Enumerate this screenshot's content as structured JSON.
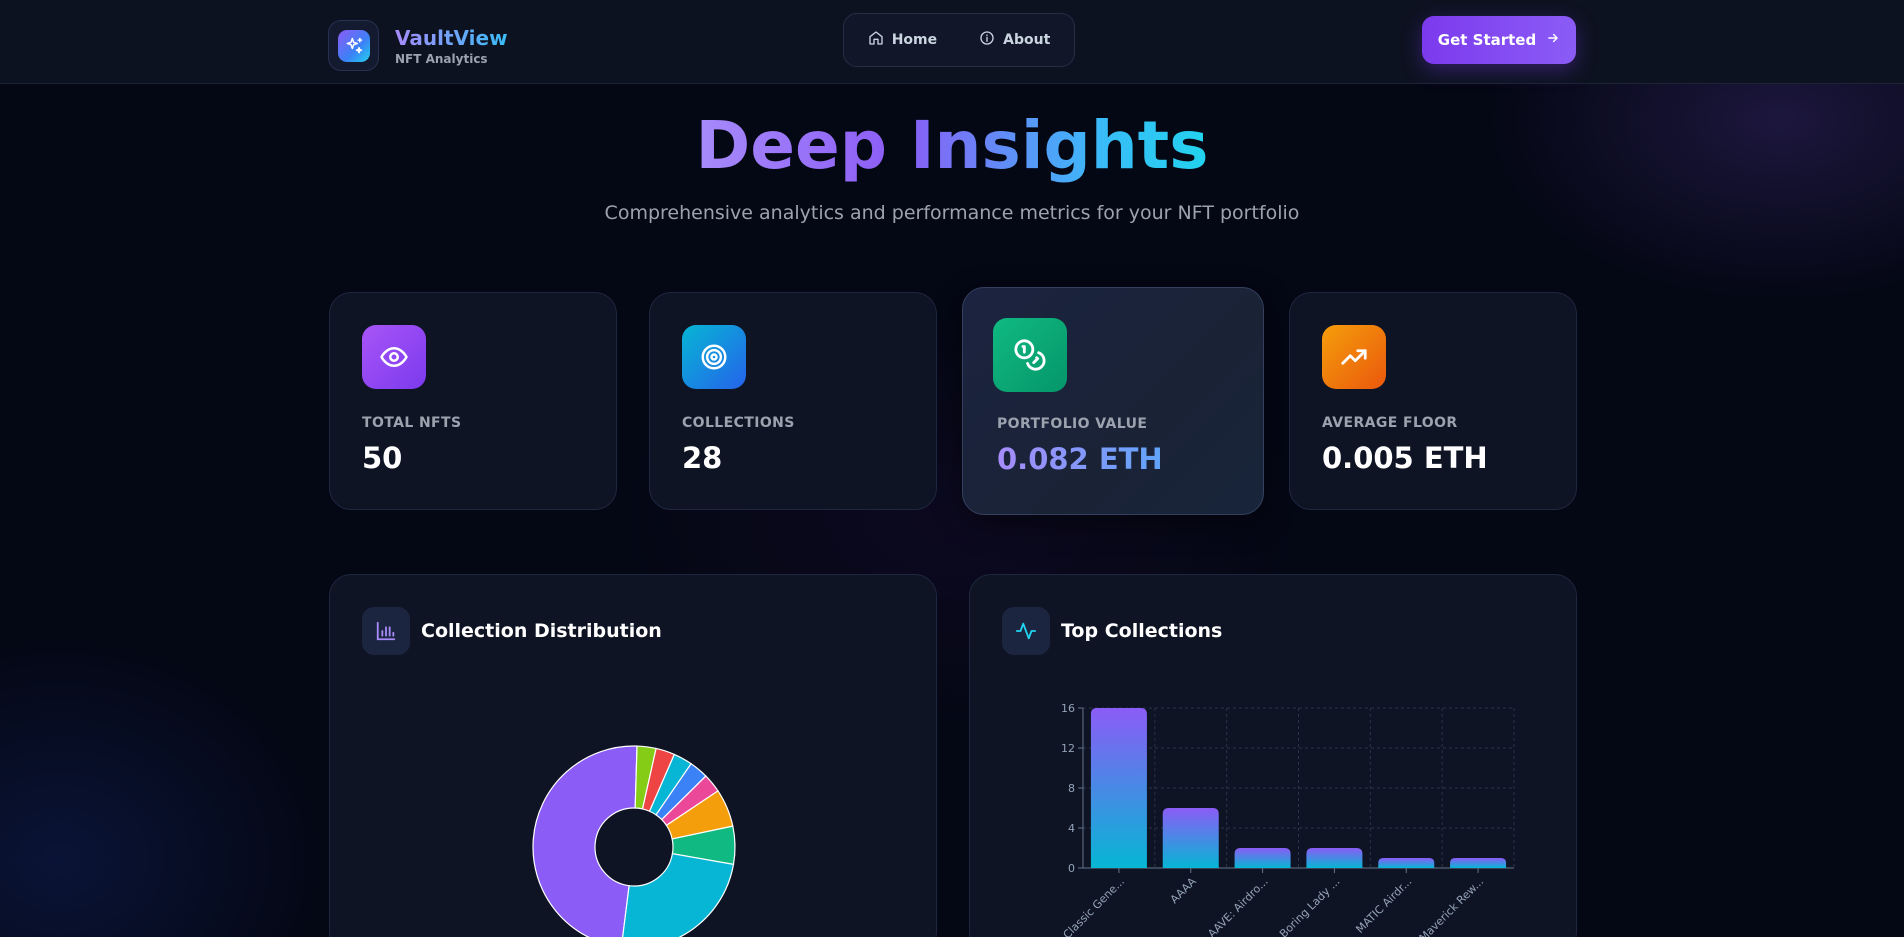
{
  "nav": {
    "brand_name": "VaultView",
    "brand_sub": "NFT Analytics",
    "links": [
      {
        "label": "Home",
        "icon": "home-icon"
      },
      {
        "label": "About",
        "icon": "info-icon"
      }
    ],
    "cta_label": "Get Started"
  },
  "hero": {
    "title": "Deep Insights",
    "subtitle": "Comprehensive analytics and performance metrics for your NFT portfolio"
  },
  "stats": [
    {
      "label": "TOTAL NFTS",
      "value": "50",
      "icon": "eye-icon",
      "color": "#8b5cf6"
    },
    {
      "label": "COLLECTIONS",
      "value": "28",
      "icon": "target-icon",
      "color": "#0ea5e9"
    },
    {
      "label": "PORTFOLIO VALUE",
      "value": "0.082 ETH",
      "icon": "coins-icon",
      "color": "#10b981"
    },
    {
      "label": "AVERAGE FLOOR",
      "value": "0.005 ETH",
      "icon": "trending-up-icon",
      "color": "#f97316"
    }
  ],
  "panels": {
    "distribution_title": "Collection Distribution",
    "top_title": "Top Collections"
  },
  "chart_data": [
    {
      "type": "pie",
      "title": "Collection Distribution",
      "donut": true,
      "slices": [
        {
          "value": 16,
          "color": "#8b5cf6"
        },
        {
          "value": 1,
          "color": "#84cc16"
        },
        {
          "value": 1,
          "color": "#ef4444"
        },
        {
          "value": 1,
          "color": "#06b6d4"
        },
        {
          "value": 1,
          "color": "#3b82f6"
        },
        {
          "value": 1,
          "color": "#ec4899"
        },
        {
          "value": 2,
          "color": "#f59e0b"
        },
        {
          "value": 2,
          "color": "#10b981"
        },
        {
          "value": 8,
          "color": "#06b6d4"
        }
      ]
    },
    {
      "type": "bar",
      "title": "Top Collections",
      "categories": [
        "Classic Gene...",
        "AAAA",
        "AAVE: Airdro...",
        "Boring Lady ...",
        "MATIC Airdr...",
        "Maverick Rew..."
      ],
      "values": [
        16,
        6,
        2,
        2,
        1,
        1
      ],
      "yticks": [
        0,
        4,
        8,
        12,
        16
      ],
      "ylim": [
        0,
        16
      ],
      "grid": true,
      "bar_gradient": [
        "#8b5cf6",
        "#06b6d4"
      ]
    }
  ]
}
